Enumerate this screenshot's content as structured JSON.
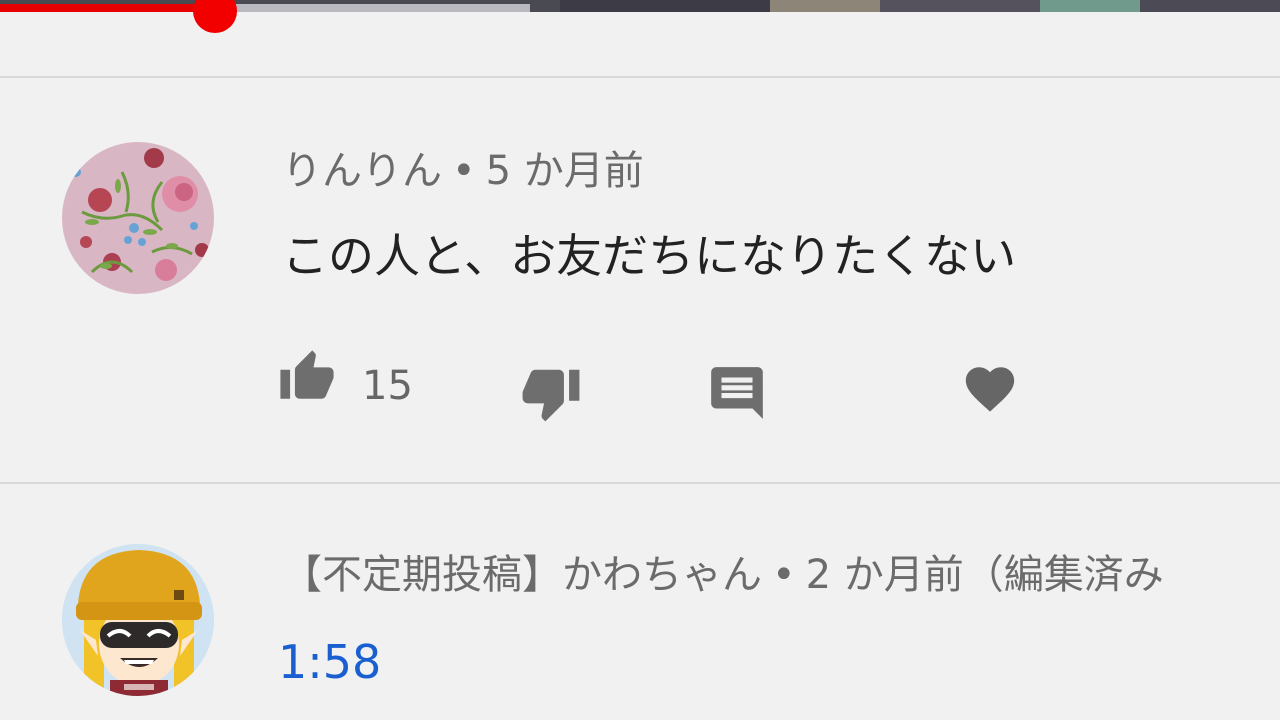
{
  "player": {
    "played_fraction": 0.168,
    "buffered_fraction": 0.414,
    "colors": {
      "played": "#e60000",
      "scrubber": "#f20000",
      "buffered": "#b9b9bf"
    }
  },
  "comments": [
    {
      "author": "りんりん",
      "separator": "•",
      "time": "5 か月前",
      "text": "この人と、お友だちになりたくない",
      "like_count": "15",
      "icons": [
        "thumbs-up-icon",
        "thumbs-down-icon",
        "reply-icon",
        "heart-icon"
      ],
      "avatar": "floral-pattern-avatar"
    },
    {
      "author": "【不定期投稿】かわちゃん",
      "separator": "•",
      "time": "2 か月前",
      "edited": "（編集済み",
      "timestamp_link": "1:58",
      "avatar": "inkling-girl-avatar"
    }
  ]
}
